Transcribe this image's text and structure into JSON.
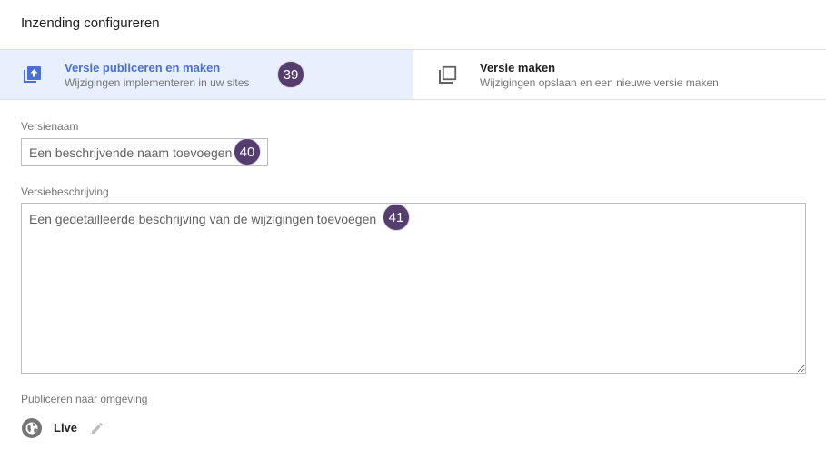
{
  "header": {
    "title": "Inzending configureren"
  },
  "options": [
    {
      "title": "Versie publiceren en maken",
      "subtitle": "Wijzigingen implementeren in uw sites",
      "icon": "publish-icon",
      "selected": true
    },
    {
      "title": "Versie maken",
      "subtitle": "Wijzigingen opslaan en een nieuwe versie maken",
      "icon": "version-icon",
      "selected": false
    }
  ],
  "version_name": {
    "label": "Versienaam",
    "placeholder": "Een beschrijvende naam toevoegen",
    "value": ""
  },
  "version_description": {
    "label": "Versiebeschrijving",
    "placeholder": "Een gedetailleerde beschrijving van de wijzigingen toevoegen",
    "value": ""
  },
  "environment": {
    "label": "Publiceren naar omgeving",
    "name": "Live",
    "icon": "globe-icon"
  },
  "badges": {
    "publish_option": "39",
    "name_field": "40",
    "description_field": "41"
  },
  "colors": {
    "accent": "#4a6fd6",
    "selected_bg": "#e8f0fe",
    "badge_bg": "#553d6e"
  }
}
